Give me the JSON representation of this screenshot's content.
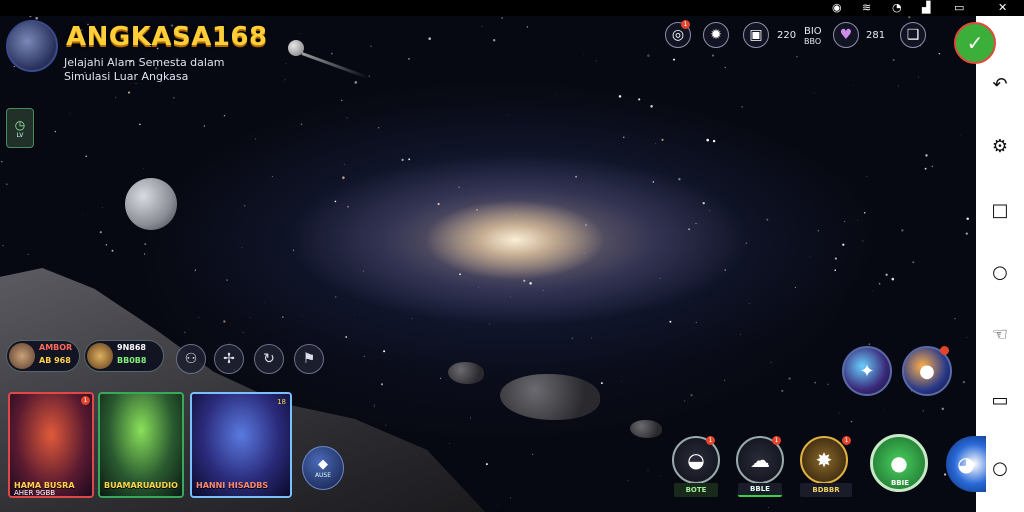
{
  "status_bar": {
    "icons": [
      "signal-icon",
      "wifi-icon",
      "timer-icon",
      "cellular-icon",
      "battery-icon",
      "close-icon"
    ]
  },
  "logo": {
    "title": "ANGKASA168",
    "subtitle_line1": "Jelajahi Alam Semesta dalam",
    "subtitle_line2": "Simulasi Luar Angkasa"
  },
  "top_bar": {
    "resource1_value": "220",
    "resource2_label": "BIO",
    "resource2_sub": "BBO",
    "resource3_value": "281",
    "notification_badge": "1"
  },
  "side_button": {
    "label": "LV"
  },
  "players": [
    {
      "name": "AMBOR",
      "stat": "AB 968",
      "color": "#ff6a5a"
    },
    {
      "name": "9N868",
      "stat": "BB0B8",
      "color": "#f0f0f0"
    }
  ],
  "heroes": [
    {
      "label": "HAMA BUSRA",
      "tag": "AHER 9GBB",
      "accent": "#e04848",
      "badge": "1"
    },
    {
      "label": "BUAMARUAUDIO",
      "tag": "",
      "accent": "#3aa85a",
      "badge": ""
    },
    {
      "label": "HANNI HISADBS",
      "tag": "",
      "accent": "#3a6ad8",
      "badge": "18"
    }
  ],
  "gem": {
    "label": "AUSE"
  },
  "actions": [
    {
      "label": "BOTE",
      "badge": "1"
    },
    {
      "label": "BBLE",
      "badge": "1"
    },
    {
      "label": "BDBBR",
      "badge": "1"
    },
    {
      "label": "BBIE",
      "badge": ""
    }
  ],
  "colors": {
    "title_gold": "#ffcf3a",
    "confirm_green": "#3cae3a",
    "notification_red": "#e2452b"
  }
}
